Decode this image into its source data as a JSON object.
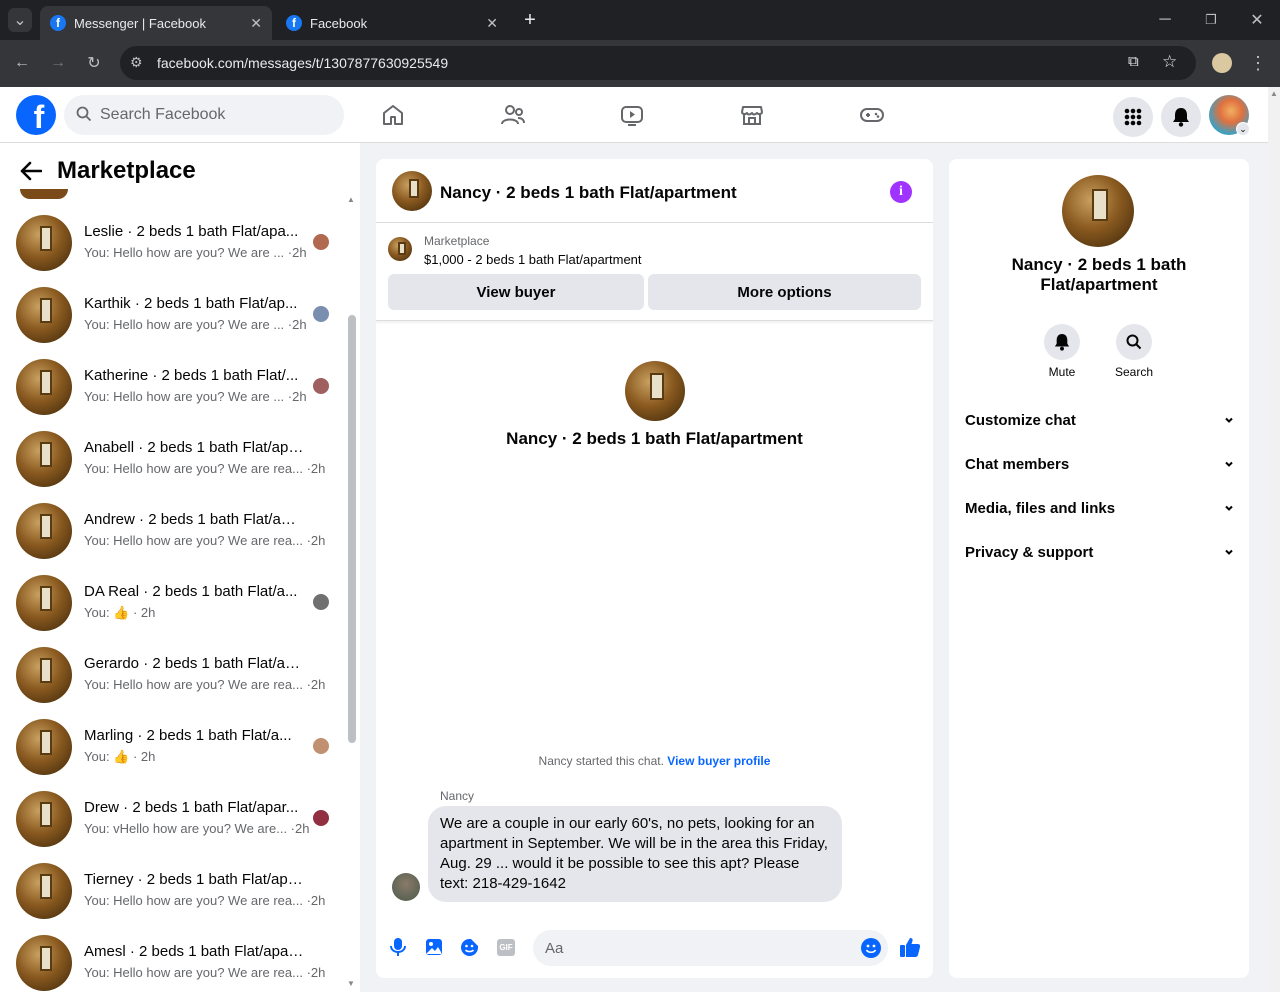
{
  "browser": {
    "tabs": [
      {
        "title": "Messenger | Facebook"
      },
      {
        "title": "Facebook"
      }
    ],
    "url": "facebook.com/messages/t/1307877630925549"
  },
  "topbar": {
    "search_placeholder": "Search Facebook"
  },
  "left": {
    "title": "Marketplace",
    "conversations": [
      {
        "name": "Leslie · 2 beds 1 bath Flat/apa...",
        "preview": "You: Hello how are you? We are ... ·2h",
        "dot": "#b06a50"
      },
      {
        "name": "Karthik · 2 beds 1 bath Flat/ap...",
        "preview": "You: Hello how are you? We are ... ·2h",
        "dot": "#7a8fb0"
      },
      {
        "name": "Katherine · 2 beds 1 bath Flat/...",
        "preview": "You: Hello how are you? We are ... ·2h",
        "dot": "#a06060"
      },
      {
        "name": "Anabell · 2 beds 1 bath Flat/apar...",
        "preview": "You: Hello how are you? We are rea... ·2h",
        "dot": ""
      },
      {
        "name": "Andrew · 2 beds 1 bath Flat/apar...",
        "preview": "You: Hello how are you? We are rea... ·2h",
        "dot": ""
      },
      {
        "name": "DA Real · 2 beds 1 bath Flat/a...",
        "preview": "You: 👍 · 2h",
        "dot": "#707070"
      },
      {
        "name": "Gerardo · 2 beds 1 bath Flat/apa...",
        "preview": "You: Hello how are you? We are rea... ·2h",
        "dot": ""
      },
      {
        "name": "Marling · 2 beds 1 bath Flat/a...",
        "preview": "You: 👍 · 2h",
        "dot": "#c09070"
      },
      {
        "name": "Drew · 2 beds 1 bath Flat/apar...",
        "preview": "You: vHello how are you? We are... ·2h",
        "dot": "#903040"
      },
      {
        "name": "Tierney · 2 beds 1 bath Flat/apar...",
        "preview": "You: Hello how are you? We are rea... ·2h",
        "dot": ""
      },
      {
        "name": "Amesl · 2 beds 1 bath Flat/apart...",
        "preview": "You: Hello how are you? We are rea... ·2h",
        "dot": ""
      }
    ]
  },
  "chat": {
    "header_title": "Nancy · 2 beds 1 bath Flat/apartment",
    "listing_label": "Marketplace",
    "listing_detail": "$1,000 - 2 beds 1 bath Flat/apartment",
    "view_buyer": "View buyer",
    "more_options": "More options",
    "intro_name": "Nancy · 2 beds 1 bath Flat/apartment",
    "started_text": "Nancy started this chat.",
    "view_buyer_profile": "View buyer profile",
    "sender": "Nancy",
    "message": "We are a couple in our early 60's, no pets, looking for an apartment in September.  We will be in the area this Friday, Aug. 29 ... would it be possible to see this apt?  Please text: 218-429-1642",
    "composer_placeholder": "Aa"
  },
  "info": {
    "name": "Nancy · 2 beds 1 bath Flat/apartment",
    "mute": "Mute",
    "search": "Search",
    "sections": [
      "Customize chat",
      "Chat members",
      "Media, files and links",
      "Privacy & support"
    ]
  },
  "colors": {
    "accent": "#0866ff",
    "info_icon": "#a033ff"
  }
}
